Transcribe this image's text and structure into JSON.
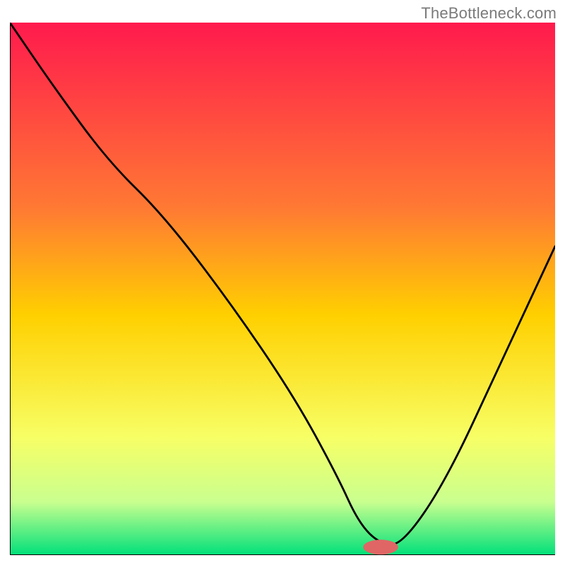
{
  "watermark": "TheBottleneck.com",
  "chart_data": {
    "type": "line",
    "title": "",
    "xlabel": "",
    "ylabel": "",
    "xlim": [
      0,
      100
    ],
    "ylim": [
      0,
      100
    ],
    "grid": false,
    "legend": false,
    "background_gradient_stops": [
      {
        "offset": 0,
        "color": "#ff1a4d"
      },
      {
        "offset": 35,
        "color": "#ff7a33"
      },
      {
        "offset": 55,
        "color": "#ffd000"
      },
      {
        "offset": 78,
        "color": "#f7ff66"
      },
      {
        "offset": 90,
        "color": "#c9ff8f"
      },
      {
        "offset": 100,
        "color": "#00e07a"
      }
    ],
    "series": [
      {
        "name": "bottleneck-curve",
        "color": "#000000",
        "x": [
          0,
          8,
          18,
          28,
          40,
          52,
          60,
          64,
          68,
          72,
          80,
          90,
          100
        ],
        "values": [
          100,
          88,
          74,
          64,
          48,
          30,
          15,
          6,
          2,
          2,
          14,
          36,
          58
        ]
      }
    ],
    "marker": {
      "name": "optimal-marker",
      "color": "#e06666",
      "x": 68,
      "y": 1.5,
      "rx": 3.2,
      "ry": 1.4
    },
    "axis_line_color": "#000000"
  }
}
